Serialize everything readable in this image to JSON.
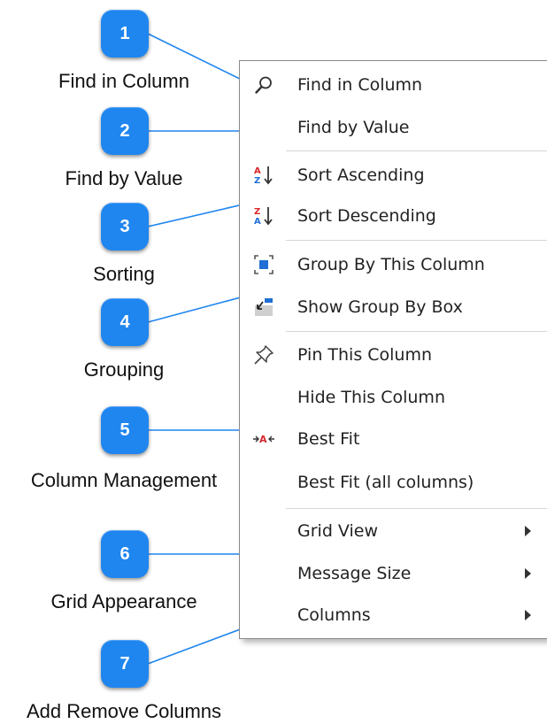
{
  "callouts": [
    {
      "number": "1",
      "label": "Find in Column"
    },
    {
      "number": "2",
      "label": "Find by Value"
    },
    {
      "number": "3",
      "label": "Sorting"
    },
    {
      "number": "4",
      "label": "Grouping"
    },
    {
      "number": "5",
      "label": "Column Management"
    },
    {
      "number": "6",
      "label": "Grid Appearance"
    },
    {
      "number": "7",
      "label": "Add Remove Columns"
    }
  ],
  "menu": {
    "items": [
      {
        "label": "Find in Column",
        "icon": "magnifier-icon"
      },
      {
        "label": "Find by Value",
        "icon": ""
      },
      {
        "label": "Sort Ascending",
        "icon": "sort-ascending-icon"
      },
      {
        "label": "Sort Descending",
        "icon": "sort-descending-icon"
      },
      {
        "label": "Group By This Column",
        "icon": "group-by-column-icon"
      },
      {
        "label": "Show Group By Box",
        "icon": "group-by-box-icon"
      },
      {
        "label": "Pin This Column",
        "icon": "pin-icon"
      },
      {
        "label": "Hide This Column",
        "icon": ""
      },
      {
        "label": "Best Fit",
        "icon": "best-fit-icon"
      },
      {
        "label": "Best Fit (all columns)",
        "icon": ""
      },
      {
        "label": "Grid View",
        "icon": "",
        "submenu": true
      },
      {
        "label": "Message Size",
        "icon": "",
        "submenu": true
      },
      {
        "label": "Columns",
        "icon": "",
        "submenu": true
      }
    ]
  },
  "colors": {
    "badge": "#1f86f0",
    "callout_line": "#1f86f0",
    "sort_red": "#d9262b",
    "sort_blue": "#1f6fd6"
  }
}
